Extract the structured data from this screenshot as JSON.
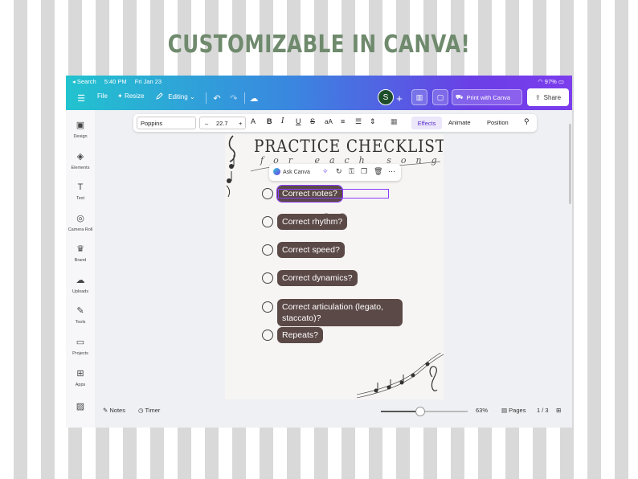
{
  "headline": "CUSTOMIZABLE IN CANVA!",
  "status_bar": {
    "back": "◂ Search",
    "time": "5:40 PM",
    "date": "Fri Jan 23",
    "battery": "97%"
  },
  "topbar": {
    "file": "File",
    "resize": "Resize",
    "editing": "Editing",
    "avatar_letter": "S",
    "print": "Print with Canva",
    "share": "Share"
  },
  "sidebar": [
    {
      "label": "Design",
      "icon": "design-icon"
    },
    {
      "label": "Elements",
      "icon": "elements-icon"
    },
    {
      "label": "Text",
      "icon": "text-icon"
    },
    {
      "label": "Camera Roll",
      "icon": "camera-icon"
    },
    {
      "label": "Brand",
      "icon": "brand-icon"
    },
    {
      "label": "Uploads",
      "icon": "upload-icon"
    },
    {
      "label": "Tools",
      "icon": "tools-icon"
    },
    {
      "label": "Projects",
      "icon": "folder-icon"
    },
    {
      "label": "Apps",
      "icon": "apps-icon"
    }
  ],
  "context_toolbar": {
    "font": "Poppins",
    "minus": "–",
    "size": "22.7",
    "plus": "+",
    "effects": "Effects",
    "animate": "Animate",
    "position": "Position"
  },
  "element_toolbar": {
    "ask": "Ask Canva"
  },
  "document": {
    "title": "PRACTICE CHECKLIST",
    "subtitle": "for each song",
    "items": [
      "Correct notes?",
      "Correct rhythm?",
      "Correct speed?",
      "Correct dynamics?",
      "Correct articulation (legato, staccato)?",
      "Repeats?"
    ]
  },
  "bottom_bar": {
    "notes": "Notes",
    "timer": "Timer",
    "zoom": "63%",
    "pages": "Pages",
    "page_count": "1 / 3",
    "zoom_level": 0.45
  },
  "colors": {
    "pill": "#5b4947",
    "accent": "#8b3dff",
    "headline": "#6f8a6d"
  }
}
